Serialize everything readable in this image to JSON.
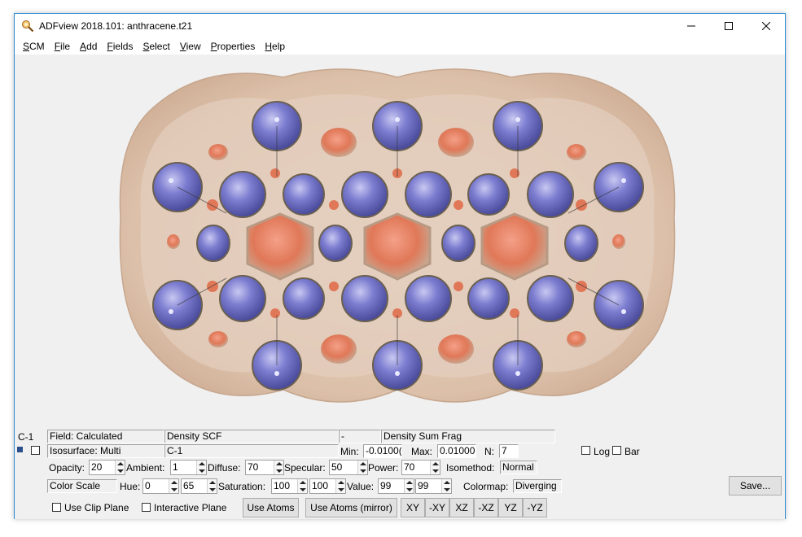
{
  "window": {
    "title": "ADFview 2018.101: anthracene.t21"
  },
  "menu": [
    {
      "underline": "S",
      "rest": "CM"
    },
    {
      "underline": "F",
      "rest": "ile"
    },
    {
      "underline": "A",
      "rest": "dd"
    },
    {
      "underline": "F",
      "rest": "ields"
    },
    {
      "underline": "S",
      "rest": "elect"
    },
    {
      "underline": "V",
      "rest": "iew"
    },
    {
      "underline": "P",
      "rest": "roperties"
    },
    {
      "underline": "H",
      "rest": "elp"
    }
  ],
  "panel": {
    "row1": {
      "id_label": "C-1",
      "field": "Field: Calculated",
      "density": "Density SCF",
      "op": "-",
      "density2": "Density Sum Frag"
    },
    "row2": {
      "isosurface": "Isosurface: Multi",
      "name": "C-1",
      "min_label": "Min:",
      "min_value": "-0.0100(",
      "max_label": "Max:",
      "max_value": "0.01000(",
      "n_label": "N:",
      "n_value": "7",
      "log_label": "Log",
      "bar_label": "Bar"
    },
    "row3": {
      "opacity_label": "Opacity:",
      "opacity_value": "20",
      "ambient_label": "Ambient:",
      "ambient_value": "1",
      "diffuse_label": "Diffuse:",
      "diffuse_value": "70",
      "specular_label": "Specular:",
      "specular_value": "50",
      "power_label": "Power:",
      "power_value": "70",
      "isomethod_label": "Isomethod:",
      "isomethod_value": "Normal"
    },
    "row4": {
      "color_scale": "Color Scale",
      "hue_label": "Hue:",
      "hue_value1": "0",
      "hue_value2": "65",
      "saturation_label": "Saturation:",
      "saturation_value1": "100",
      "saturation_value2": "100",
      "value_label": "Value:",
      "value_value1": "99",
      "value_value2": "99",
      "colormap_label": "Colormap:",
      "colormap_value": "Diverging",
      "save_label": "Save..."
    },
    "row5": {
      "clip_label": "Use Clip Plane",
      "interactive_label": "Interactive Plane",
      "use_atoms": "Use Atoms",
      "use_atoms_mirror": "Use Atoms (mirror)",
      "xy": "XY",
      "mxy": "-XY",
      "xz": "XZ",
      "mxz": "-XZ",
      "yz": "YZ",
      "myz": "-YZ"
    }
  },
  "colors": {
    "accent_border": "#2b8bd6",
    "blue_lobe": "#6f6fc8",
    "orange_lobe": "#e88464",
    "envelope": "#d9b79f"
  }
}
